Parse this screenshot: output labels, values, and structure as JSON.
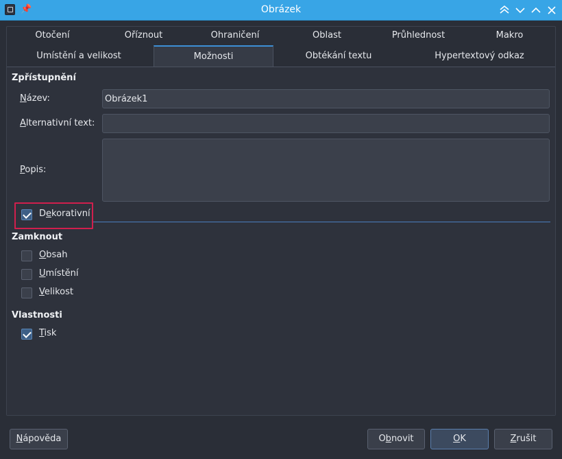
{
  "window": {
    "title": "Obrázek",
    "pin_glyph": "📌"
  },
  "tabs_row1": [
    "Otočení",
    "Oříznout",
    "Ohraničení",
    "Oblast",
    "Průhlednost",
    "Makro"
  ],
  "tabs_row2": [
    "Umístění a velikost",
    "Možnosti",
    "Obtékání textu",
    "Hypertextový odkaz"
  ],
  "active_tab": "Možnosti",
  "accessibility": {
    "title": "Zpřístupnění",
    "name_label": {
      "mnemonic": "N",
      "rest": "ázev:"
    },
    "name_value": "Obrázek1",
    "alt_label": {
      "mnemonic": "A",
      "rest": "lternativní text:"
    },
    "alt_value": "",
    "desc_label": {
      "mnemonic": "P",
      "rest": "opis:"
    },
    "desc_value": "",
    "decorative": {
      "pre": "D",
      "mnemonic": "e",
      "rest": "korativní",
      "checked": true
    }
  },
  "lock": {
    "title": "Zamknout",
    "items": [
      {
        "mnemonic": "O",
        "rest": "bsah",
        "checked": false
      },
      {
        "mnemonic": "U",
        "rest": "místění",
        "checked": false
      },
      {
        "mnemonic": "V",
        "rest": "elikost",
        "checked": false
      }
    ]
  },
  "properties": {
    "title": "Vlastnosti",
    "items": [
      {
        "mnemonic": "T",
        "rest": "isk",
        "checked": true
      }
    ]
  },
  "buttons": {
    "help": {
      "mnemonic": "N",
      "rest": "ápověda"
    },
    "reset": {
      "pre": "O",
      "mnemonic": "b",
      "rest": "novit"
    },
    "ok": {
      "mnemonic": "O",
      "rest": "K"
    },
    "cancel": {
      "mnemonic": "Z",
      "rest": "rušit"
    }
  },
  "colors": {
    "titlebar": "#38a5e6",
    "highlight": "#d11f4d",
    "accent": "#3d8fd6"
  }
}
